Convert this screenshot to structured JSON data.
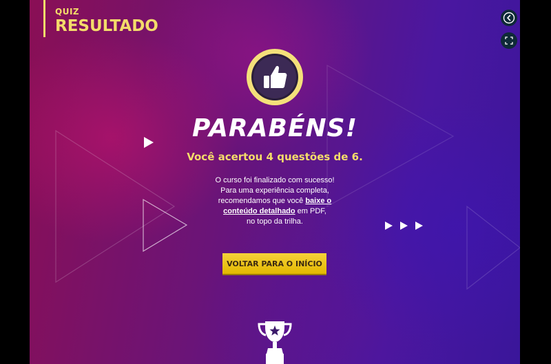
{
  "header": {
    "label": "QUIZ",
    "title": "RESULTADO"
  },
  "result": {
    "headline": "PARABÉNS!",
    "score_text": "Você acertou 4 questões de 6.",
    "message_line1": "O curso foi finalizado com sucesso!",
    "message_line2": "Para uma experiência completa,",
    "message_line3_pre": "recomendamos que você ",
    "link_part1": "baixe o",
    "link_part2": "conteúdo detalhado",
    "message_line4_post": " em PDF,",
    "message_line5": "no topo da trilha."
  },
  "actions": {
    "back_button": "VOLTAR PARA O INÍCIO"
  },
  "controls": {
    "back_icon": "back-arrow-icon",
    "fullscreen_icon": "fullscreen-icon"
  },
  "icons": {
    "badge": "thumbs-up-icon",
    "trophy": "trophy-icon"
  },
  "colors": {
    "accent": "#f4dc6a",
    "button": "#f1c40f",
    "control_bg": "#0f2a38"
  }
}
